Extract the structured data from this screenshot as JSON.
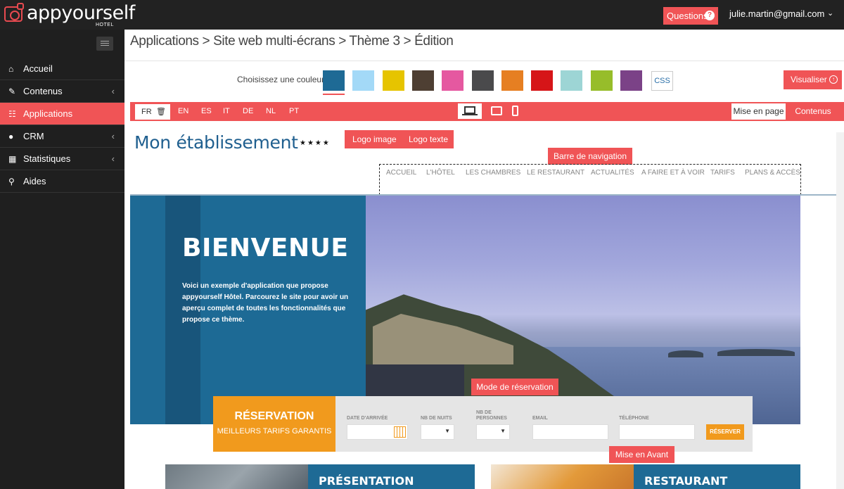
{
  "app": {
    "brand": "appyourself",
    "brand_sub": "HOTEL",
    "questions_label": "Questions",
    "user_email": "julie.martin@gmail.com"
  },
  "sidebar": {
    "items": [
      {
        "label": "Accueil",
        "icon": "home-icon"
      },
      {
        "label": "Contenus",
        "icon": "edit-icon",
        "has_submenu": true
      },
      {
        "label": "Applications",
        "icon": "sitemap-icon",
        "active": true
      },
      {
        "label": "CRM",
        "icon": "user-icon",
        "has_submenu": true
      },
      {
        "label": "Statistiques",
        "icon": "bar-chart-icon",
        "has_submenu": true
      },
      {
        "label": "Aides",
        "icon": "search-icon"
      }
    ]
  },
  "breadcrumb": "Applications > Site web multi-écrans > Thème 3 > Édition",
  "colors": {
    "label": "Choisissez une couleur",
    "swatches": [
      "#1e6a95",
      "#a3d9f7",
      "#e6c400",
      "#4e3f33",
      "#e558a0",
      "#4a4a4c",
      "#e67f22",
      "#d61518",
      "#9dd5d5",
      "#97bd2a",
      "#7b4287"
    ],
    "selected_index": 0,
    "css_label": "CSS",
    "visualiser_label": "Visualiser"
  },
  "languages": {
    "current": "FR",
    "others": [
      "EN",
      "ES",
      "IT",
      "DE",
      "NL",
      "PT"
    ]
  },
  "view_tabs": {
    "layout": "Mise en page",
    "contents": "Contenus"
  },
  "preview": {
    "site_title": "Mon établissement",
    "stars": "★★★★",
    "logo_image_label": "Logo image",
    "logo_text_label": "Logo texte",
    "nav_tag": "Barre de navigation",
    "nav_items": [
      "ACCUEIL",
      "L'HÔTEL",
      "LES CHAMBRES",
      "LE RESTAURANT",
      "ACTUALITÉS",
      "A FAIRE ET À VOIR",
      "TARIFS",
      "PLANS & ACCÈS"
    ],
    "hero_title": "BIENVENUE",
    "hero_text": "Voici un exemple d'application que propose appyourself Hôtel. Parcourez le site pour avoir un aperçu complet de toutes les fonctionnalités que propose ce thème.",
    "reservation_tag": "Mode de réservation",
    "reservation": {
      "title": "RÉSERVATION",
      "subtitle": "MEILLEURS TARIFS GARANTIS",
      "fields": [
        "DATE D'ARRIVÉE",
        "NB DE NUITS",
        "NB DE PERSONNES",
        "EMAIL",
        "TÉLÉPHONE"
      ],
      "button": "RÉSERVER"
    },
    "featured_tag": "Mise en Avant",
    "cards": [
      "PRÉSENTATION",
      "RESTAURANT"
    ]
  }
}
